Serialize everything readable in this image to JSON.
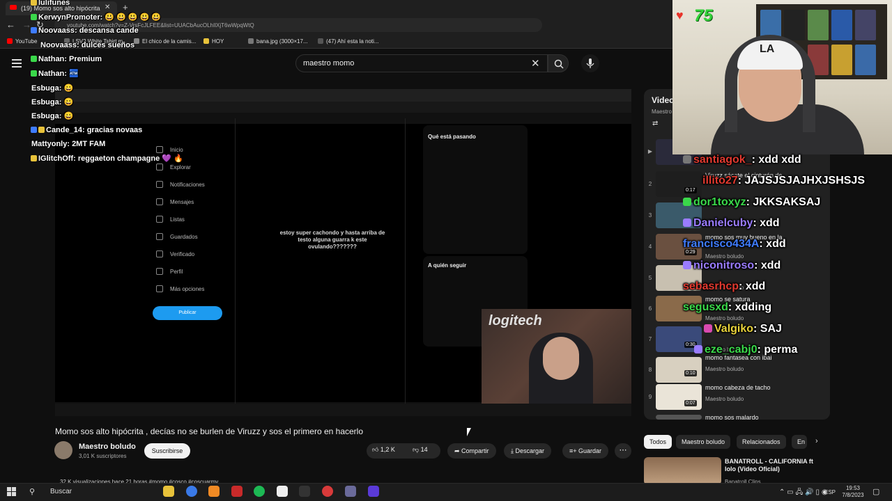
{
  "browser": {
    "tab_title": "(19) Momo sos alto hipócrita",
    "url": "youtube.com/watch?v=Z-VrsFcJLFEE&list=UUACbAucOLhIlXjT6wWpqWtQ",
    "bookmarks": [
      "YouTube",
      "LSV2 White Tshirt m...",
      "El chico de la camis...",
      "HOY",
      "bana.jpg (3000×17...",
      "(47) Ahí esta la noti..."
    ]
  },
  "search": {
    "query": "maestro momo"
  },
  "video": {
    "title": "Momo sos alto hipócrita , decías no se burlen de Viruzz y sos el primero en hacerlo",
    "channel": "Maestro boludo",
    "subscribers": "3,01 K suscriptores",
    "subscribe_label": "Suscribirse",
    "likes": "1,2 K",
    "dislikes": "14",
    "share_label": "Compartir",
    "download_label": "Descargar",
    "save_label": "Guardar",
    "views_line": "32 K visualizaciones  hace 21 horas  #momo #cosco #coscuarmy"
  },
  "inner_video": {
    "nav": [
      "Inicio",
      "Explorar",
      "Notificaciones",
      "Mensajes",
      "Listas",
      "Guardados",
      "Verificado",
      "Perfil",
      "Más opciones"
    ],
    "publish_label": "Publicar",
    "tweet_text": "estoy super cachondo y hasta arriba de testo alguna guarra k este ovulando???????",
    "trends_title": "Qué está pasando",
    "follow_title": "A quién seguir",
    "cam_brand": "logitech"
  },
  "playlist": {
    "title": "Videos",
    "channel": "Maestro boludo",
    "items": [
      {
        "num": "▶",
        "title": "",
        "channel": "",
        "duration": ""
      },
      {
        "num": "2",
        "title": "Viruzz sácate el cinturón de",
        "channel": "",
        "duration": "0:17"
      },
      {
        "num": "3",
        "title": "",
        "channel": "",
        "duration": ""
      },
      {
        "num": "4",
        "title": "momo sos muy bueno en la",
        "channel": "Maestro boludo",
        "duration": "0:29"
      },
      {
        "num": "5",
        "title": "",
        "channel": "Maestro boludo",
        "duration": ""
      },
      {
        "num": "6",
        "title": "momo se satura",
        "channel": "Maestro boludo",
        "duration": ""
      },
      {
        "num": "7",
        "title": "",
        "channel": "Maestro boludo",
        "duration": "0:30"
      },
      {
        "num": "8",
        "title": "momo fantasea con ibai",
        "channel": "Maestro boludo",
        "duration": "0:10"
      },
      {
        "num": "9",
        "title": "momo cabeza de tacho",
        "channel": "Maestro boludo",
        "duration": "0:07"
      },
      {
        "num": "",
        "title": "momo sos malardo",
        "channel": "",
        "duration": ""
      }
    ]
  },
  "chips": [
    "Todos",
    "Maestro boludo",
    "Relacionados",
    "En"
  ],
  "recommended": {
    "title": "BANATROLL - CALIFORNIA ft lolo (Video Oficial)",
    "channel": "Banatroll Clips"
  },
  "stream": {
    "viewers": "75",
    "left_chat": [
      {
        "user": "lulifunes",
        "msg": ""
      },
      {
        "user": "KerwynPromoter",
        "msg": ": 😃 😃 😃 😃 😃"
      },
      {
        "user": "Noovaass",
        "msg": ": descansa cande"
      },
      {
        "user": "Noovaass",
        "msg": ": dulces sueños"
      },
      {
        "user": "Nathan",
        "msg": ": Premium"
      },
      {
        "user": "Nathan",
        "msg": ": 🏧"
      },
      {
        "user": "Esbuga",
        "msg": ": 😀"
      },
      {
        "user": "Esbuga",
        "msg": ": 😀"
      },
      {
        "user": "Esbuga",
        "msg": ": 😀"
      },
      {
        "user": "Cande_14",
        "msg": ": gracias novaas"
      },
      {
        "user": "Mattyonly",
        "msg": ": 2MT FAM"
      },
      {
        "user": "IGlitchOff",
        "msg": ": reggaeton champagne 💜 🔥"
      }
    ],
    "right_chat": [
      {
        "user": "santiagok_",
        "msg": ": xdd xdd",
        "color": "#e0392f"
      },
      {
        "user": "illito27",
        "msg": ": JAJSJSJAJHXJSHSJS",
        "color": "#e0392f"
      },
      {
        "user": "dor1toxyz",
        "msg": ": JKKSAKSAJ",
        "color": "#3ad84a"
      },
      {
        "user": "Danielcuby",
        "msg": ": xdd",
        "color": "#9a7cff"
      },
      {
        "user": "francisco434A",
        "msg": ": xdd",
        "color": "#3f7cff"
      },
      {
        "user": "niconitroso",
        "msg": ": xdd",
        "color": "#9a7cff"
      },
      {
        "user": "sebasrhcp",
        "msg": ": xdd",
        "color": "#e0392f"
      },
      {
        "user": "segusxd",
        "msg": ": xdding",
        "color": "#3ad84a"
      },
      {
        "user": "Valgiko",
        "msg": ": SAJ",
        "color": "#e8d23a"
      },
      {
        "user": "eze_cabj0",
        "msg": ": perma",
        "color": "#3ad84a"
      }
    ]
  },
  "taskbar": {
    "search_label": "Buscar",
    "lang": "ESP",
    "time": "19:53",
    "date": "7/8/2023"
  },
  "colors": {
    "accent": "#3ea6ff",
    "youtube_red": "#ff0000",
    "viewer_green": "#33d23a"
  }
}
